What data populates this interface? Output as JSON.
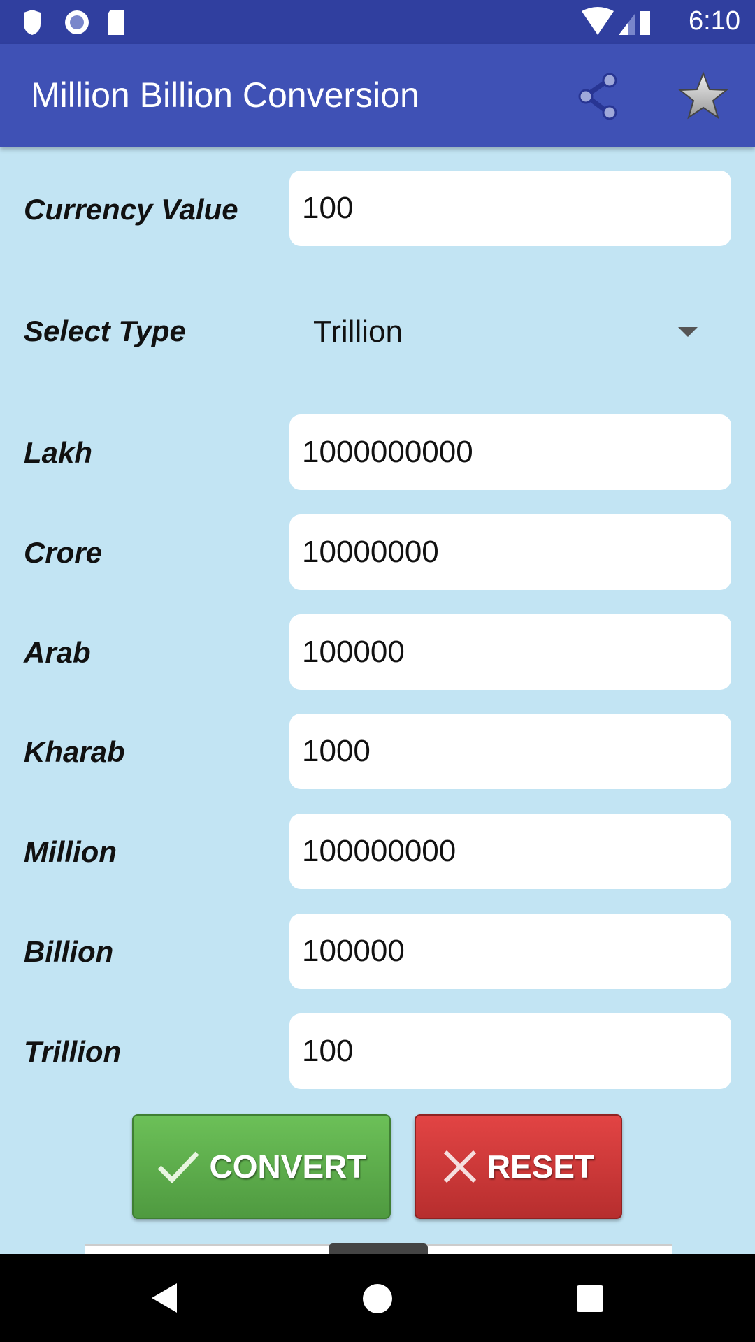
{
  "status_bar": {
    "time": "6:10",
    "icons": [
      "shield-icon",
      "circle-icon",
      "sd-card-icon",
      "wifi-icon",
      "signal-icon",
      "battery-charging-icon"
    ]
  },
  "app_bar": {
    "title": "Million Billion Conversion",
    "actions": [
      "share-icon",
      "star-icon"
    ]
  },
  "form": {
    "currency_label": "Currency Value",
    "currency_value": "100",
    "type_label": "Select Type",
    "type_value": "Trillion",
    "results": [
      {
        "label": "Lakh",
        "value": "1000000000"
      },
      {
        "label": "Crore",
        "value": "10000000"
      },
      {
        "label": "Arab",
        "value": "100000"
      },
      {
        "label": "Kharab",
        "value": "1000"
      },
      {
        "label": "Million",
        "value": "100000000"
      },
      {
        "label": "Billion",
        "value": "100000"
      },
      {
        "label": "Trillion",
        "value": "100"
      }
    ]
  },
  "buttons": {
    "convert": "CONVERT",
    "reset": "RESET"
  },
  "colors": {
    "primary": "#3f51b5",
    "primary_dark": "#303f9f",
    "background": "#c2e4f3",
    "convert": "#5aa948",
    "reset": "#d33c3c"
  }
}
